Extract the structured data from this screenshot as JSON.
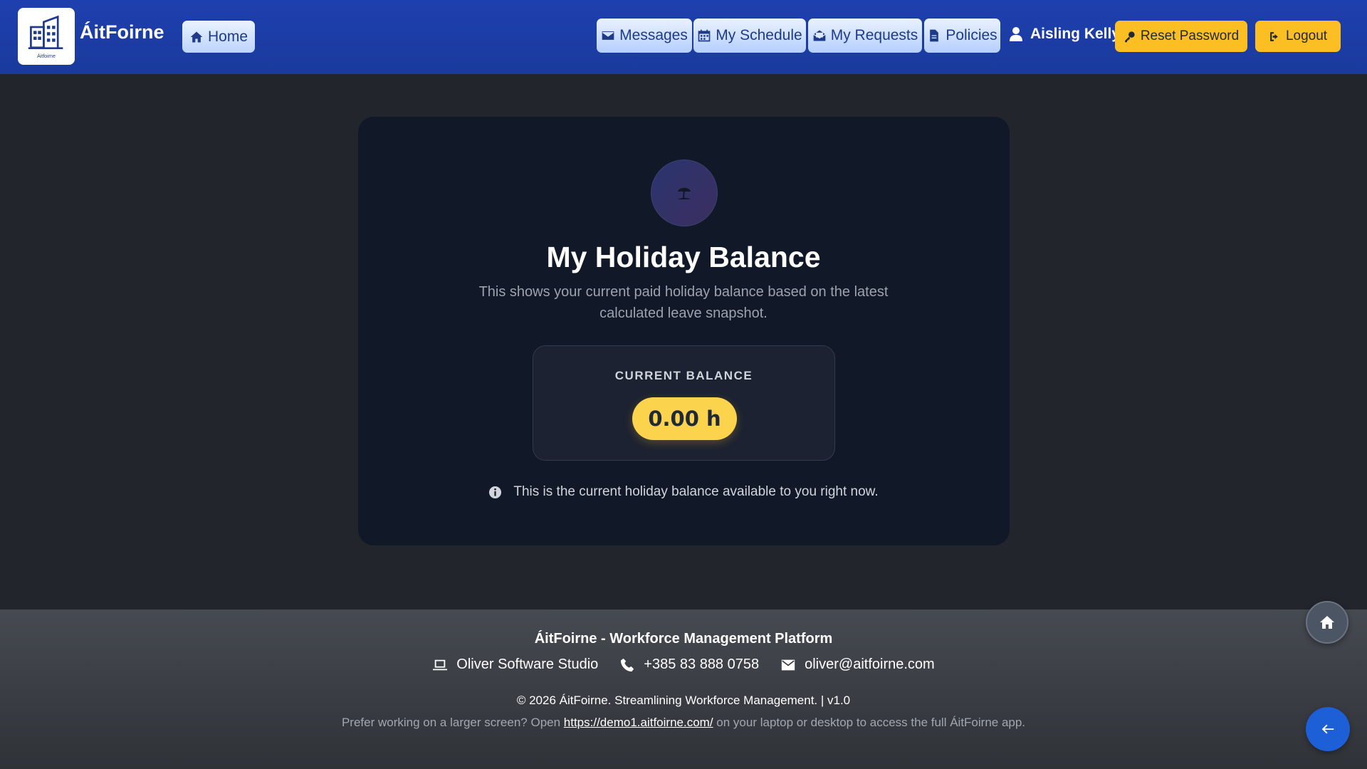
{
  "navbar": {
    "brand": "ÁitFoirne",
    "logo_caption": "Áitfoirne",
    "home_label": "Home",
    "links": [
      {
        "label": "Messages",
        "icon": "envelope-icon"
      },
      {
        "label": "My Schedule",
        "icon": "calendar-icon"
      },
      {
        "label": "My Requests",
        "icon": "envelope-open-icon"
      },
      {
        "label": "Policies",
        "icon": "document-icon"
      }
    ],
    "user_name": "Aisling Kelly",
    "reset_password_label": "Reset Password",
    "logout_label": "Logout"
  },
  "card": {
    "icon": "umbrella-beach-icon",
    "title": "My Holiday Balance",
    "description": "This shows your current paid holiday balance based on the latest calculated leave snapshot.",
    "balance_label": "CURRENT BALANCE",
    "balance_value": "0.00 h",
    "note": "This is the current holiday balance available to you right now."
  },
  "footer": {
    "title": "ÁitFoirne - Workforce Management Platform",
    "company": "Oliver Software Studio",
    "phone": "+385 83 888 0758",
    "email": "oliver@aitfoirne.com",
    "copyright": "© 2026 ÁitFoirne. Streamlining Workforce Management. | v1.0",
    "hint_before": "Prefer working on a larger screen? Open ",
    "hint_link": "https://demo1.aitfoirne.com/",
    "hint_after": " on your laptop or desktop to access the full ÁitFoirne app."
  },
  "colors": {
    "navbar": "#1e40af",
    "accent_yellow": "#fbbf24",
    "card_bg": "#111827",
    "page_bg": "#22252b",
    "fab_blue": "#1d5fd6"
  }
}
